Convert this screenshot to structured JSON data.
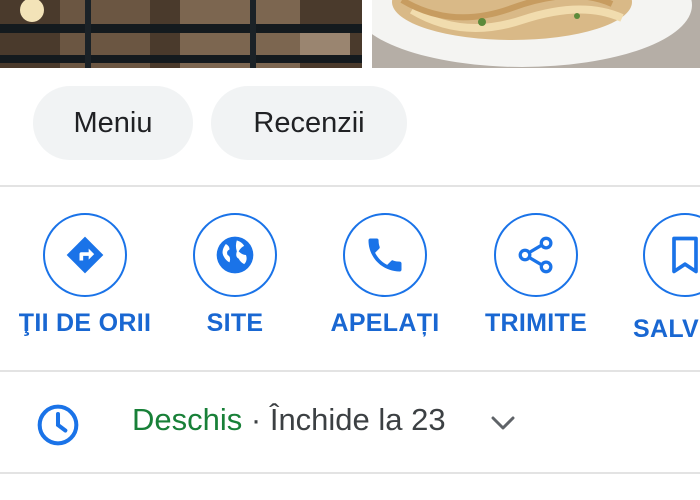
{
  "chips": {
    "menu_label": "Meniu",
    "reviews_label": "Recenzii"
  },
  "actions": [
    {
      "label": "ŢII DE ORII",
      "icon": "directions-icon"
    },
    {
      "label": "SITE",
      "icon": "globe-icon"
    },
    {
      "label": "APELAȚI",
      "icon": "phone-icon"
    },
    {
      "label": "TRIMITE",
      "icon": "share-icon"
    },
    {
      "label": "SALV",
      "icon": "bookmark-icon"
    }
  ],
  "hours": {
    "status": "Deschis",
    "separator": " · ",
    "closing": "Închide la 23"
  },
  "colors": {
    "accent": "#1a73e8",
    "open_status": "#188038",
    "chip_background": "#f1f3f4"
  }
}
